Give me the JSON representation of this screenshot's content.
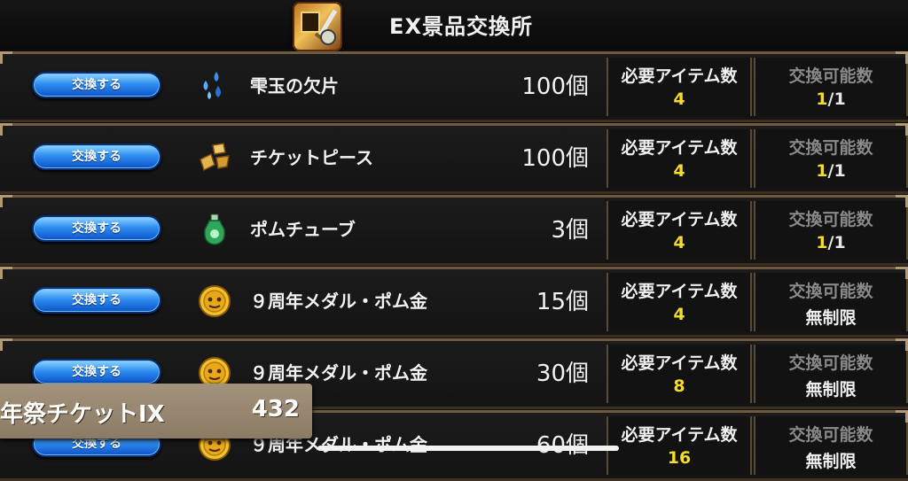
{
  "header": {
    "title": "EX景品交換所",
    "icon": "ex-shop-emblem-icon"
  },
  "exchange_label": "交換する",
  "required_label": "必要アイテム数",
  "limit_label": "交換可能数",
  "rows": [
    {
      "item": "雫玉の欠片",
      "icon": "droplet-shards-icon",
      "qty": "100個",
      "required": "4",
      "limit_current": "1",
      "limit_sep_total": "/1",
      "limit_text": ""
    },
    {
      "item": "チケットピース",
      "icon": "ticket-pieces-icon",
      "qty": "100個",
      "required": "4",
      "limit_current": "1",
      "limit_sep_total": "/1",
      "limit_text": ""
    },
    {
      "item": "ポムチューブ",
      "icon": "potion-bottle-icon",
      "qty": "3個",
      "required": "4",
      "limit_current": "1",
      "limit_sep_total": "/1",
      "limit_text": ""
    },
    {
      "item": "９周年メダル・ポム金",
      "icon": "gold-medal-icon",
      "qty": "15個",
      "required": "4",
      "limit_current": "",
      "limit_sep_total": "",
      "limit_text": "無制限"
    },
    {
      "item": "９周年メダル・ポム金",
      "icon": "gold-medal-icon",
      "qty": "30個",
      "required": "8",
      "limit_current": "",
      "limit_sep_total": "",
      "limit_text": "無制限"
    },
    {
      "item": "９周年メダル・ポム金",
      "icon": "gold-medal-icon",
      "qty": "60個",
      "required": "16",
      "limit_current": "",
      "limit_sep_total": "",
      "limit_text": "無制限"
    }
  ],
  "ticket": {
    "name": "年祭チケットIX",
    "count": "432"
  },
  "colors": {
    "accent_yellow": "#f4dc2a",
    "button_blue": "#2e8ef0",
    "frame_gold": "#b19a73"
  }
}
